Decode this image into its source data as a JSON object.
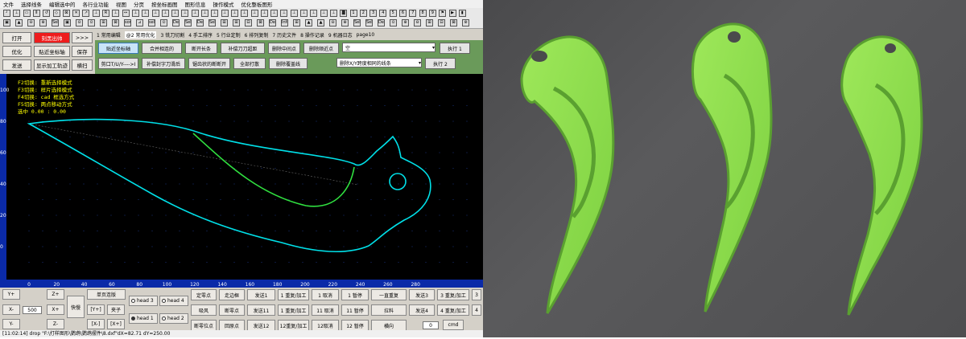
{
  "menu": [
    "文件",
    "选择线条",
    "编辑选中的",
    "各行业功能",
    "视图",
    "分页",
    "按坐标画图",
    "图形信息",
    "操作模式",
    "优化整板图形"
  ],
  "toolbar": {
    "row1": [
      "┘",
      "⊥",
      "▭",
      "Ⅱ",
      "↺",
      "◇",
      "⊠",
      "✕",
      "↗",
      "⊥",
      "R",
      "⊥",
      "↔",
      "⊥",
      "⊥",
      "⊥",
      "⊥",
      "⊥",
      "⊥",
      "⊥",
      "⊥",
      "⊥",
      "⊥",
      "⊥",
      "⊥",
      "⊥",
      "⊥",
      "⊥",
      "⊥",
      "⊥",
      "⊥",
      "⊥",
      "⊥",
      "⊥",
      "▓",
      "1",
      "2",
      "3",
      "4",
      "5",
      "6",
      "7",
      "8",
      "9",
      "⚑",
      "▶",
      "▮"
    ],
    "row2": [
      "▣",
      "▲",
      "⊖",
      "⊕",
      "Sel",
      "▣",
      "⊝",
      "⊙",
      "⊞",
      "⊠",
      "sort",
      "⊿",
      "sel",
      "⊙",
      "Del",
      "Sel",
      "Del",
      "Sel",
      "⊞",
      "⊞",
      "⊟",
      "⊠",
      "Del",
      "Info",
      "⊞",
      "▲",
      "▲",
      "⊖",
      "⊕",
      "Sel",
      "Sel",
      "Del",
      "⊙",
      "⊕",
      "⊖",
      "⊞",
      "⊟",
      "⊠",
      "⊛"
    ]
  },
  "left": {
    "open": "打开",
    "cut_speed": "刻黑出帅",
    "nav": ">>>",
    "optimize": "优化",
    "snap_axis": "贴近坐标轴",
    "save": "保存",
    "send": "发送",
    "show_path": "显示加工轨迹",
    "horizontal": "横扫"
  },
  "tabs": [
    "1 常用编辑",
    "@2 常用优化",
    "3 铣刀切割",
    "4 手工排序",
    "5 行业定制",
    "6 排列复制",
    "7 历史文件",
    "8 操作记录",
    "9 机器日志",
    "page10"
  ],
  "active_tab": 1,
  "green": {
    "r1": [
      "贴近坐标轴",
      "合并相连的",
      "断开长条",
      "补偿刀刀超距",
      "删除中间点",
      "删除顺近点"
    ],
    "r2": [
      "剪口T/U/Y---->I",
      "补偿封字刀滑后",
      "锯齿状的断断开",
      "全部打散",
      "删除覆盖线"
    ],
    "select1": "空",
    "exec1": "执行 1",
    "select2": "删除X/Y跨度相同的线条",
    "exec2": "执行 2"
  },
  "canvas": {
    "hints": [
      "F2切换: 重新选择模式",
      "F3切换: 样片选择模式",
      "F4切换: cad 框选方式",
      "F5切换: 两点移动方式",
      "选中 0.00 : 0.00"
    ],
    "y_ticks": [
      "100",
      "80",
      "60",
      "40",
      "20",
      "0"
    ],
    "x_ticks": [
      "0",
      "20",
      "40",
      "60",
      "80",
      "100",
      "120",
      "140",
      "160",
      "180",
      "200",
      "220",
      "240",
      "260",
      "280"
    ]
  },
  "bottom": {
    "yplus": "Y+",
    "xminus": "X-",
    "xplus": "X+",
    "yminus": "Y-",
    "zplus": "Z+",
    "zminus": "Z-",
    "step": "500",
    "fast": "快慢",
    "single_page": "单页连版",
    "ybtn_plus": "[Y+]",
    "ybtn_minus": "[X-]",
    "xbtn_plus": "[X+]",
    "clamp": "夹子",
    "head3": "head 3",
    "head4": "head 4",
    "head1": "head 1",
    "head2": "head 2",
    "col5": [
      "定零点",
      "吸风",
      "断零位点"
    ],
    "col6": [
      "走边框",
      "断零点",
      "回原点"
    ],
    "col7": [
      "发送1",
      "发送11",
      "发送12"
    ],
    "col8": [
      "1 重复/加工",
      "1 重复/加工",
      "12重复/加工"
    ],
    "col9": [
      "1 取消",
      "11 取消",
      "12取消"
    ],
    "col10": [
      "1 暂停",
      "11 暂停",
      "12 暂停"
    ],
    "col11": [
      "一直重复",
      "拉料",
      "横向"
    ],
    "col12": [
      "发送3",
      "发送4"
    ],
    "col13": [
      "3 重复/加工",
      "4 重复/加工"
    ],
    "col14": [
      "3",
      "4"
    ],
    "input_val": "0",
    "cmd": "cmd"
  },
  "status": "[11:02:14] drop \"F:\\打样图形\\鹦鹉\\鹦鹉摆件\\8.dxf\"dX=82.71 dY=250.00",
  "colors": {
    "outline": "#00e0e8",
    "inner": "#30e040",
    "foam": "#8ee04a",
    "hint": "#ffff00"
  }
}
